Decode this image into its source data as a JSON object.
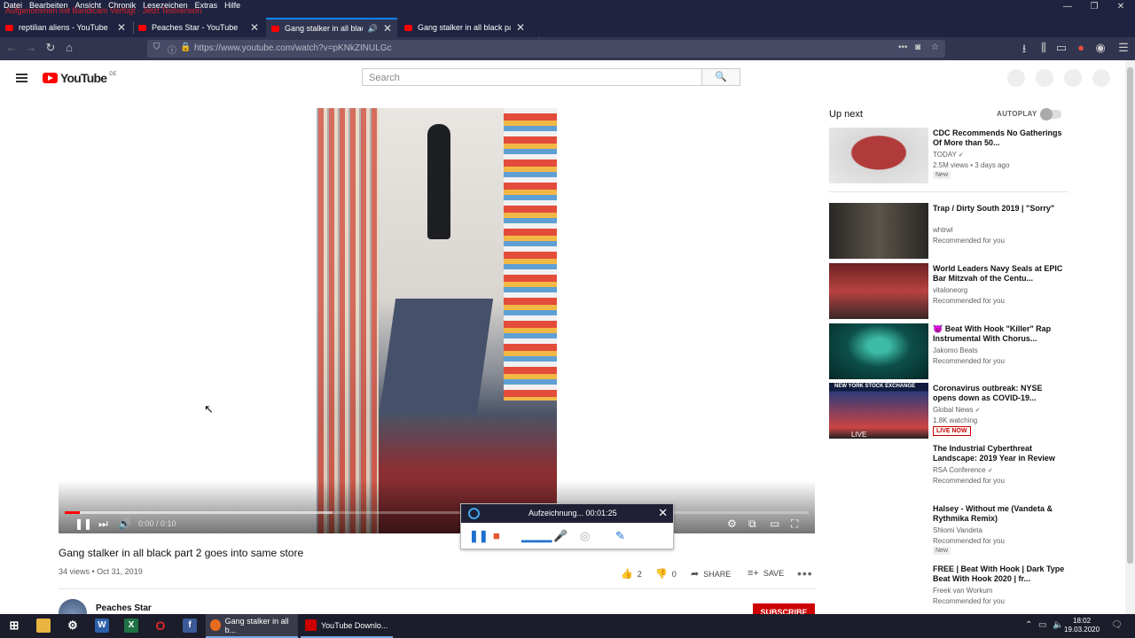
{
  "browser": {
    "menu": [
      "Datei",
      "Bearbeiten",
      "Ansicht",
      "Chronik",
      "Lesezeichen",
      "Extras",
      "Hilfe"
    ],
    "overlay_text": "Aufgenommen mit Bandicam Verfügt · Jetzt Testversion",
    "tabs": [
      {
        "title": "reptilian aliens - YouTube",
        "active": false
      },
      {
        "title": "Peaches Star - YouTube",
        "active": false
      },
      {
        "title": "Gang stalker in all black part 2",
        "active": true
      },
      {
        "title": "Gang stalker in all black part 1",
        "active": false
      }
    ],
    "url": "https://www.youtube.com/watch?v=pKNkZINULGc"
  },
  "youtube": {
    "logo_text": "YouTube",
    "region": "DE",
    "search_placeholder": "Search"
  },
  "player": {
    "time": "0:00 / 0:10",
    "progress_fraction": 0.02,
    "buffered_fraction": 0.36
  },
  "recorder": {
    "label": "Aufzeichnung... 00:01:25"
  },
  "video": {
    "title": "Gang stalker in all black part 2 goes into same store",
    "meta": "34 views • Oct 31, 2019",
    "likes": "2",
    "dislikes": "0",
    "share": "SHARE",
    "save": "SAVE",
    "channel": "Peaches Star",
    "subscribe": "SUBSCRIBE"
  },
  "sidebar": {
    "up_next": "Up next",
    "autoplay": "AUTOPLAY",
    "items": [
      {
        "title": "CDC Recommends No Gatherings Of More than 50...",
        "channel": "TODAY",
        "verified": true,
        "info": "2.5M views • 3 days ago",
        "badge": "New",
        "thumb_color": "#8f2a2a"
      },
      {
        "title": "Trap / Dirty South 2019 | \"Sorry\"",
        "channel": "whtrwl",
        "verified": false,
        "info": "Recommended for you",
        "badge": "",
        "thumb_color": "#3a3732"
      },
      {
        "title": "World Leaders Navy Seals at EPIC Bar Mitzvah of the Centu...",
        "channel": "vitaloneorg",
        "verified": false,
        "info": "Recommended for you",
        "badge": "",
        "thumb_color": "#5b2f2f"
      },
      {
        "title": "😈 Beat With Hook \"Killer\" Rap Instrumental With Chorus...",
        "channel": "Jakomo Beats",
        "verified": false,
        "info": "Recommended for you",
        "badge": "",
        "thumb_color": "#0f4a46"
      },
      {
        "title": "Coronavirus outbreak: NYSE opens down as COVID-19...",
        "channel": "Global News",
        "verified": true,
        "info": "1.8K watching",
        "badge": "LIVE NOW",
        "thumb_color": "#1c2b5e",
        "thumb_label": "LIVE",
        "thumb_banner": "NEW YORK STOCK EXCHANGE"
      },
      {
        "title": "The Industrial Cyberthreat Landscape: 2019 Year in Review",
        "channel": "RSA Conference",
        "verified": true,
        "info": "Recommended for you",
        "badge": "",
        "thumb_color": "#ffffff"
      },
      {
        "title": "Halsey - Without me (Vandeta & Rythmika Remix)",
        "channel": "Shlomi Vandeta",
        "verified": false,
        "info": "Recommended for you",
        "badge": "New",
        "thumb_color": "#ffffff"
      },
      {
        "title": "FREE | Beat With Hook | Dark Type Beat With Hook 2020 | fr...",
        "channel": "Freek van Workum",
        "verified": false,
        "info": "Recommended for you",
        "badge": "",
        "thumb_color": "#ffffff"
      }
    ]
  },
  "taskbar": {
    "apps": [
      {
        "label": "Gang stalker in all b..."
      },
      {
        "label": "YouTube Downlo..."
      }
    ],
    "time": "18:02",
    "date": "19.03.2020"
  }
}
